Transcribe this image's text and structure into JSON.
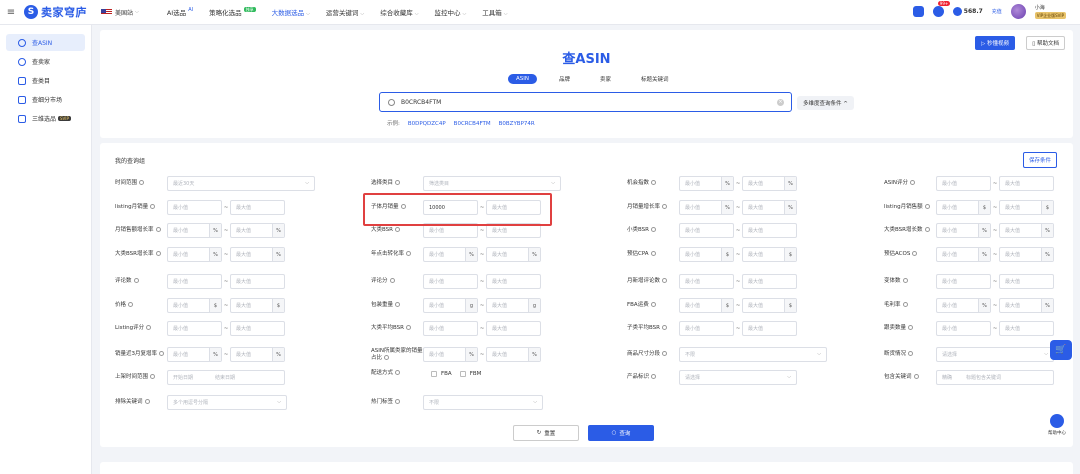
{
  "header": {
    "brand": "卖家穹庐",
    "site": "美国站",
    "nav": [
      {
        "label": "AI选品",
        "sup": "AI"
      },
      {
        "label": "策略化选品",
        "badge": "独享"
      },
      {
        "label": "大数据选品"
      },
      {
        "label": "运营关键词"
      },
      {
        "label": "综合收藏库"
      },
      {
        "label": "监控中心"
      },
      {
        "label": "工具箱"
      }
    ],
    "notif_count": "99+",
    "balance": "568.7",
    "recharge": "充值",
    "user": "小海",
    "vip": "VIP企业版SVIP"
  },
  "sidebar": {
    "items": [
      {
        "label": "查ASIN"
      },
      {
        "label": "查卖家"
      },
      {
        "label": "查类目"
      },
      {
        "label": "查细分市场"
      },
      {
        "label": "三维选品",
        "badge": "SVIP"
      }
    ]
  },
  "main": {
    "title": "查ASIN",
    "tabs": [
      "ASIN",
      "品牌",
      "卖家",
      "标题关键词"
    ],
    "search_value": "B0CRCB4FTM",
    "multi": "多维度查询条件 ^",
    "examples_label": "示例:",
    "examples": [
      "B0DPQDZC4P",
      "B0CRCB4FTM",
      "B0BZYBP74R"
    ],
    "video_btn": "秒懂视频",
    "help_btn": "帮助文档"
  },
  "panel": {
    "title": "我的查询组",
    "save": "保存条件",
    "min": "最小值",
    "max": "最大值",
    "reset": "重置",
    "query": "查询",
    "time_range": "最近30天",
    "category_ph": "筛选类目",
    "sub_sales_min": "10000",
    "not_limited": "不限",
    "select_ph": "请选择",
    "start": "开始日期",
    "end": "结束日期",
    "sep_kw_ph": "多个用逗号分隔",
    "exact": "精确",
    "include_ph": "标题包含关键词",
    "fba": "FBA",
    "fbm": "FBM",
    "labels": [
      "时间范围",
      "选择类目",
      "机会指数",
      "ASIN评分",
      "listing月销量",
      "子体月销量",
      "月销量增长率",
      "listing月销售额",
      "月销售额增长率",
      "大类BSR",
      "小类BSR",
      "大类BSR增长数",
      "大类BSR增长率",
      "年点击转化率",
      "预估CPA",
      "预估ACOS",
      "评论数",
      "评论分",
      "月新增评论数",
      "变体数",
      "价格",
      "包装重量",
      "FBA运费",
      "毛利率",
      "Listing评分",
      "大类平均BSR",
      "子类平均BSR",
      "跟卖数量",
      "销量近3月复增率",
      "ASIN所属类家的销量占比",
      "商品尺寸分段",
      "断货情况",
      "上架时间范围",
      "配送方式",
      "产品标识",
      "包含关键词",
      "排除关键词",
      "热门标签"
    ]
  },
  "help_center": "帮助中心"
}
